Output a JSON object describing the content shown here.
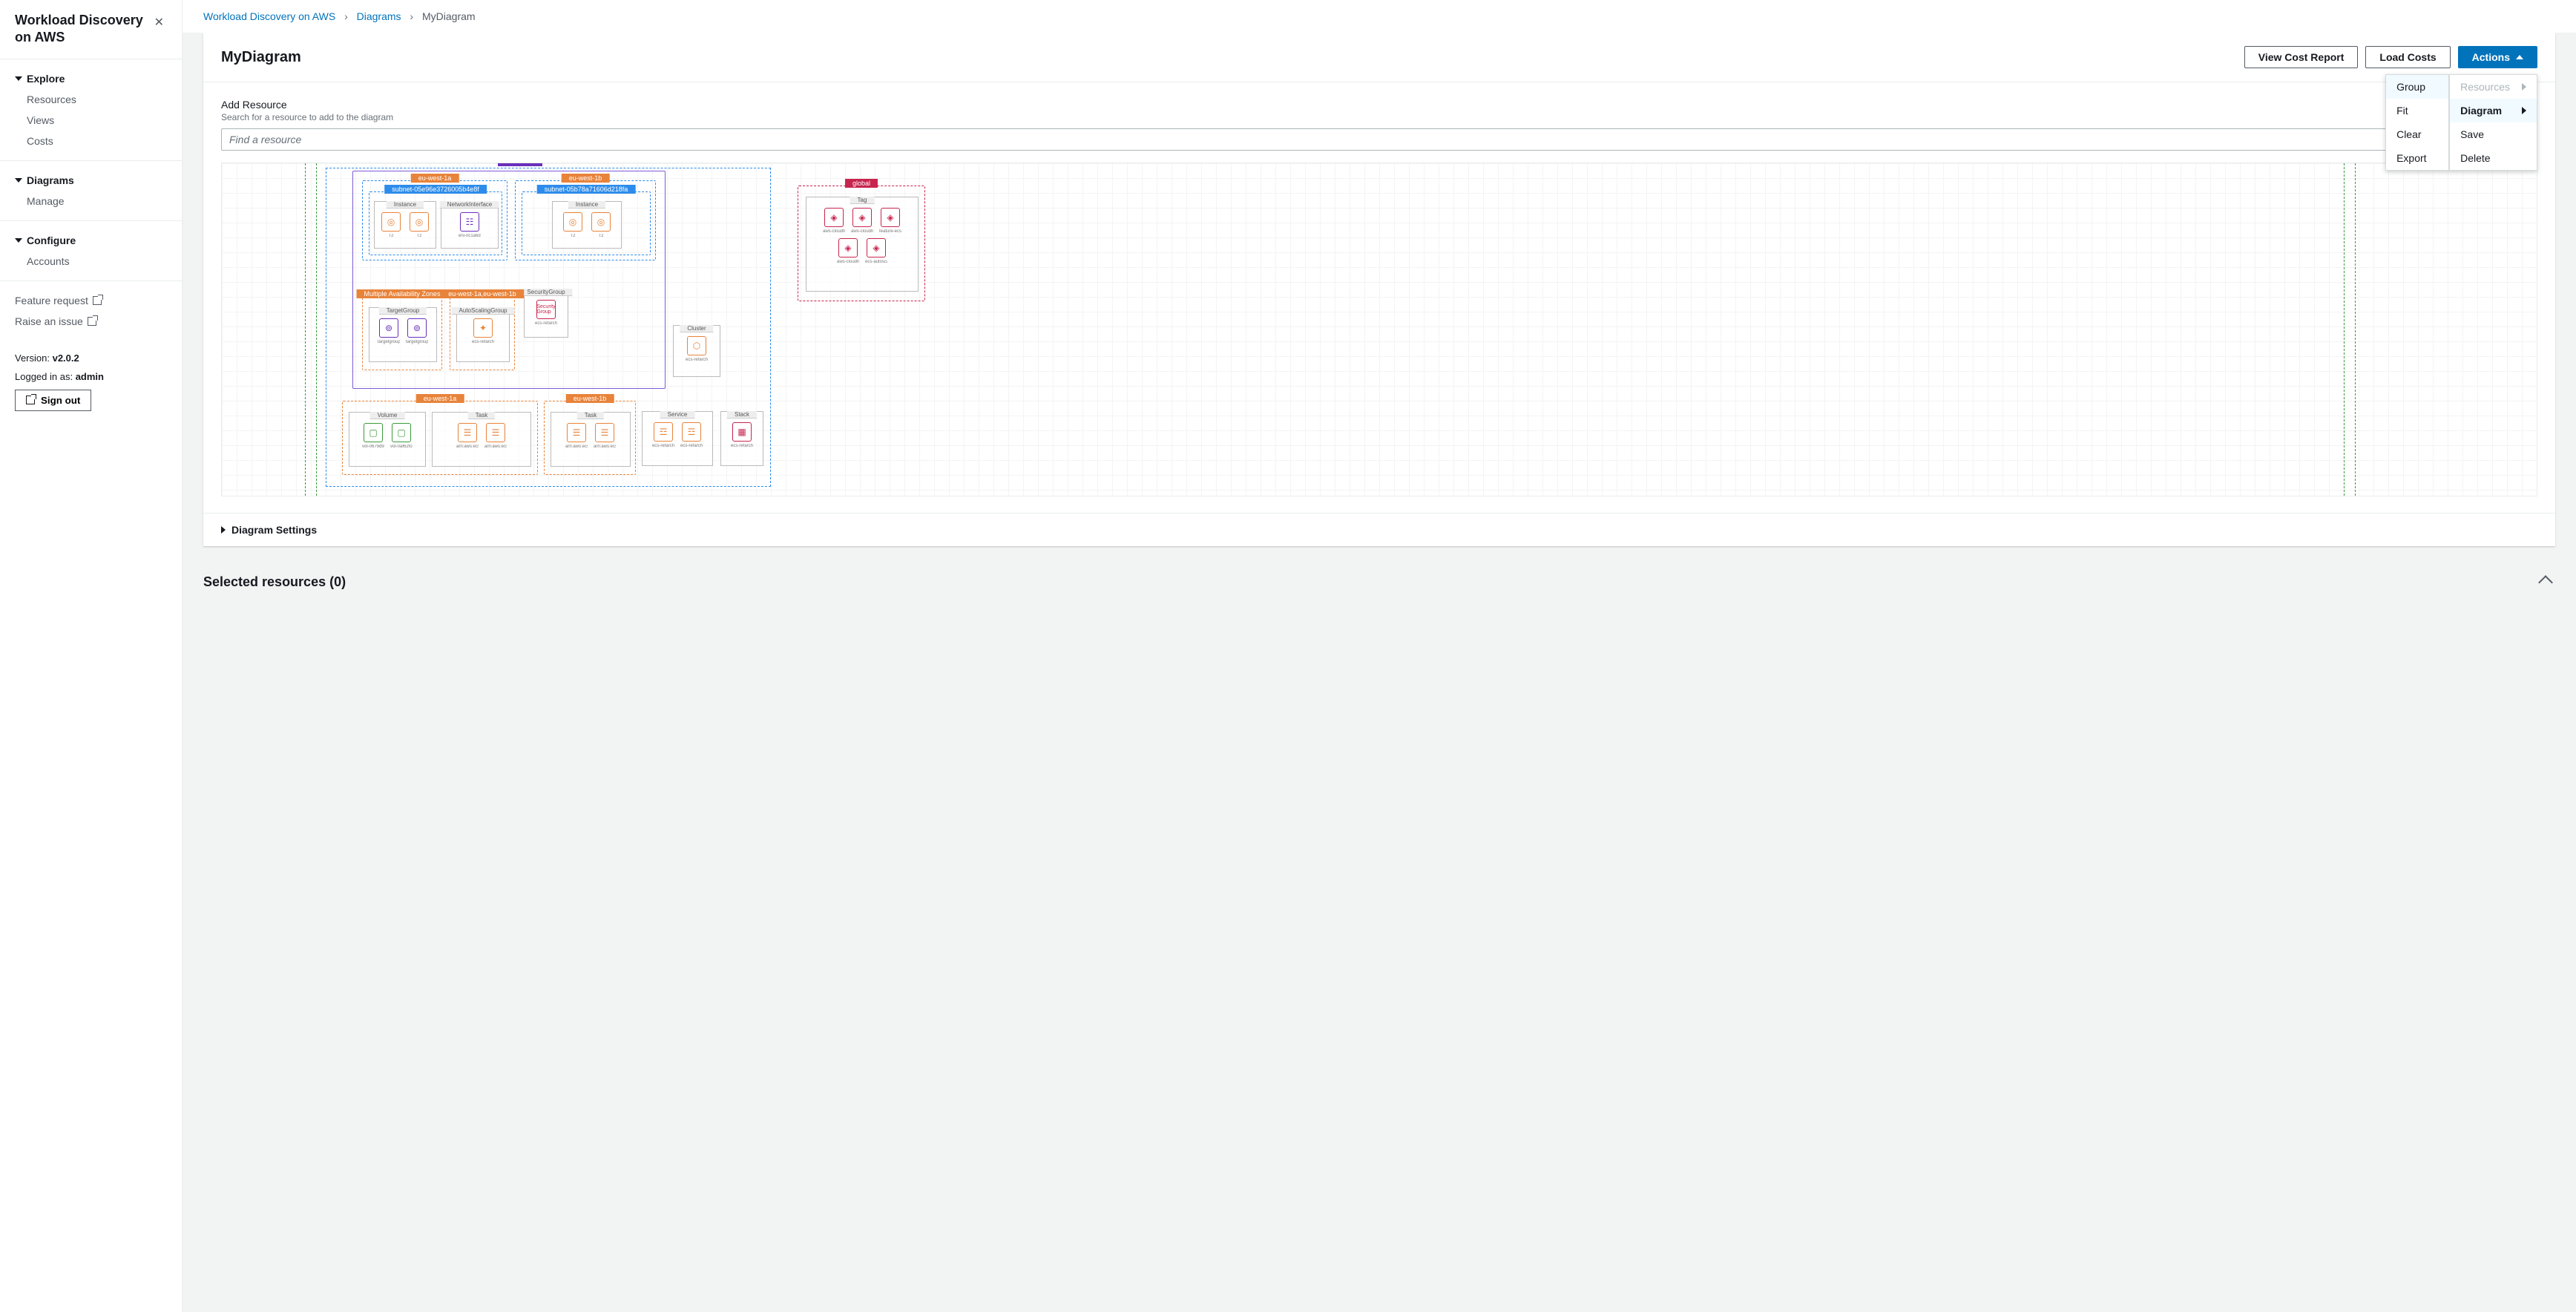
{
  "app": {
    "title": "Workload Discovery on AWS"
  },
  "sidebar": {
    "groups": [
      {
        "label": "Explore",
        "items": [
          "Resources",
          "Views",
          "Costs"
        ]
      },
      {
        "label": "Diagrams",
        "items": [
          "Manage"
        ]
      },
      {
        "label": "Configure",
        "items": [
          "Accounts"
        ]
      }
    ],
    "links": [
      {
        "label": "Feature request"
      },
      {
        "label": "Raise an issue"
      }
    ],
    "version_prefix": "Version: ",
    "version": "v2.0.2",
    "login_prefix": "Logged in as: ",
    "user": "admin",
    "signout": "Sign out"
  },
  "breadcrumb": {
    "items": [
      "Workload Discovery on AWS",
      "Diagrams",
      "MyDiagram"
    ]
  },
  "page": {
    "title": "MyDiagram",
    "buttons": {
      "cost_report": "View Cost Report",
      "load_costs": "Load Costs",
      "actions": "Actions"
    },
    "dropdown": {
      "col1": [
        "Group",
        "Fit",
        "Clear",
        "Export"
      ],
      "col2": {
        "resources": "Resources",
        "diagram": "Diagram",
        "save": "Save",
        "delete": "Delete"
      }
    },
    "add_resource": {
      "label": "Add Resource",
      "hint": "Search for a resource to add to the diagram",
      "placeholder": "Find a resource"
    },
    "settings_label": "Diagram Settings",
    "selected_label": "Selected resources (0)"
  },
  "diagram": {
    "zones": {
      "az1": "eu-west-1a",
      "az2": "eu-west-1b",
      "subnet1": "subnet-05e96e3726005b4e8f",
      "subnet2": "subnet-05b78a71606d218fa",
      "multi_az": "Multiple Availability Zones",
      "az_pair": "eu-west-1a,eu-west-1b",
      "global": "global",
      "az1b": "eu-west-1a",
      "az2b": "eu-west-1b"
    },
    "boxes": {
      "instance": "Instance",
      "nic": "NetworkInterface",
      "sg": "SecurityGroup",
      "sg_small": "Security Group",
      "tg": "TargetGroup",
      "asg": "AutoScalingGroup",
      "cluster": "Cluster",
      "tag": "Tag",
      "volume": "Volume",
      "task": "Task",
      "service": "Service",
      "stack": "Stack"
    },
    "captions": {
      "t2": "T2",
      "ecs_refarch": "ecs-refarch...",
      "eni": "eni-0c1a6d3...",
      "aws_cloudfor": "aws-cloudfor...",
      "feature_ecs": "feature-ecs-ref...",
      "ecs_autoscal": "ecs-autoscal...",
      "targetgroup": "targetgroup/...",
      "vol1": "vol-0679d94...",
      "vol2": "vol-0af62fc8...",
      "arn": "arn:aws:ecs...",
      "arn2": "arn:aws:ecs..."
    }
  }
}
